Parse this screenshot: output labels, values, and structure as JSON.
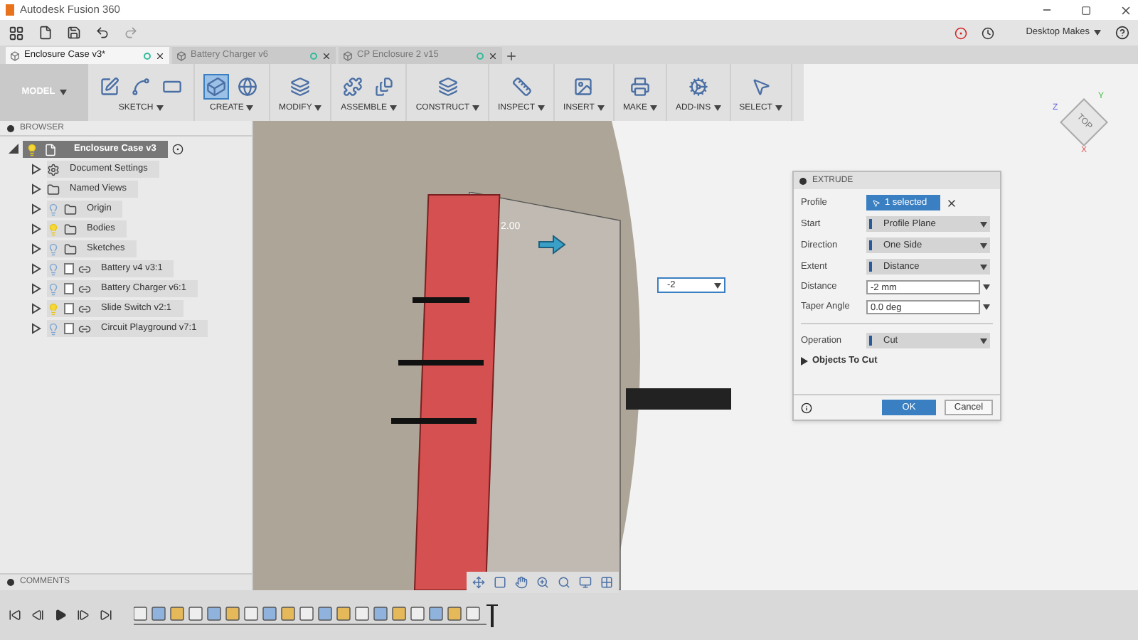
{
  "window": {
    "title": "Autodesk Fusion 360"
  },
  "toolbar": {
    "user": "Desktop Makes"
  },
  "tabs": [
    {
      "label": "Enclosure Case v3*",
      "selected": true
    },
    {
      "label": "Battery Charger v6",
      "selected": false
    },
    {
      "label": "CP Enclosure 2 v15",
      "selected": false
    }
  ],
  "ribbon": {
    "mode": "MODEL",
    "groups": [
      {
        "label": "SKETCH",
        "selected": false
      },
      {
        "label": "CREATE",
        "selected": true
      },
      {
        "label": "MODIFY",
        "selected": false
      },
      {
        "label": "ASSEMBLE",
        "selected": false
      },
      {
        "label": "CONSTRUCT",
        "selected": false
      },
      {
        "label": "INSPECT",
        "selected": false
      },
      {
        "label": "INSERT",
        "selected": false
      },
      {
        "label": "MAKE",
        "selected": false
      },
      {
        "label": "ADD-INS",
        "selected": false
      },
      {
        "label": "SELECT",
        "selected": false
      }
    ]
  },
  "browser": {
    "title": "BROWSER",
    "root": {
      "label": "Enclosure Case v3",
      "expanded": true,
      "visible": true,
      "children": [
        {
          "kind": "settings",
          "label": "Document Settings",
          "expanded": false
        },
        {
          "kind": "folder",
          "label": "Named Views",
          "expanded": false
        },
        {
          "kind": "folder",
          "label": "Origin",
          "expanded": false,
          "visible": false
        },
        {
          "kind": "folder",
          "label": "Bodies",
          "expanded": false,
          "visible": true
        },
        {
          "kind": "folder",
          "label": "Sketches",
          "expanded": false,
          "visible": false
        },
        {
          "kind": "component",
          "label": "Battery v4 v3:1",
          "expanded": false,
          "visible": false
        },
        {
          "kind": "component",
          "label": "Battery Charger v6:1",
          "expanded": false,
          "visible": false
        },
        {
          "kind": "component",
          "label": "Slide Switch v2:1",
          "expanded": false,
          "visible": true
        },
        {
          "kind": "component",
          "label": "Circuit Playground v7:1",
          "expanded": false,
          "visible": false
        }
      ]
    }
  },
  "comments": {
    "title": "COMMENTS"
  },
  "viewport": {
    "dimension": "2.00",
    "distance_input": "-2",
    "viewcube": "TOP",
    "axes": [
      "Z",
      "X",
      "Y"
    ]
  },
  "extrude": {
    "title": "EXTRUDE",
    "rows": [
      {
        "kind": "selection",
        "label": "Profile",
        "value": "1 selected"
      },
      {
        "kind": "dropdown",
        "label": "Start",
        "value": "Profile Plane"
      },
      {
        "kind": "dropdown",
        "label": "Direction",
        "value": "One Side"
      },
      {
        "kind": "dropdown",
        "label": "Extent",
        "value": "Distance"
      },
      {
        "kind": "input",
        "label": "Distance",
        "value": "-2 mm"
      },
      {
        "kind": "input",
        "label": "Taper Angle",
        "value": "0.0 deg"
      },
      {
        "kind": "dropdown",
        "label": "Operation",
        "value": "Cut"
      }
    ],
    "section": {
      "label": "Objects To Cut",
      "expanded": false
    },
    "buttons": [
      "OK",
      "Cancel"
    ]
  }
}
